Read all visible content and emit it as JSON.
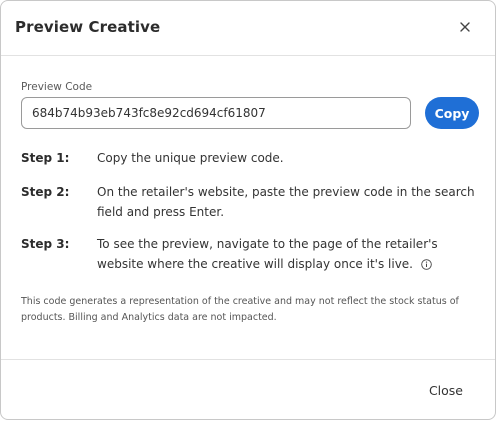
{
  "dialog": {
    "title": "Preview Creative",
    "close_icon": "close-icon"
  },
  "preview_code": {
    "label": "Preview Code",
    "value": "684b74b93eb743fc8e92cd694cf61807",
    "copy_label": "Copy"
  },
  "steps": [
    {
      "label": "Step 1:",
      "text": "Copy the unique preview code."
    },
    {
      "label": "Step 2:",
      "text": "On the retailer's website, paste the preview code in the search field and press Enter."
    },
    {
      "label": "Step 3:",
      "text": "To see the preview, navigate to the page of the retailer's website where the creative will display once it's live.",
      "icon": "info-icon"
    }
  ],
  "footnote": "This code generates a representation of the creative and may not reflect the stock status of products. Billing and Analytics data are not impacted.",
  "footer": {
    "close_label": "Close"
  },
  "colors": {
    "accent": "#1f6fd6",
    "text": "#333333"
  }
}
